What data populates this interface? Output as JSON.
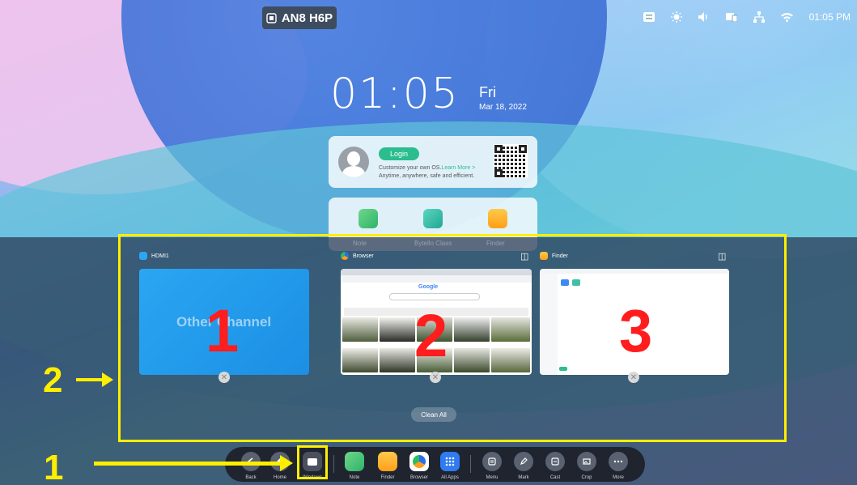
{
  "device_badge": {
    "label": "AN8 H6P"
  },
  "status_bar": {
    "time": "01:05 PM"
  },
  "clock": {
    "time": "01:05",
    "day": "Fri",
    "date": "Mar 18, 2022"
  },
  "login_card": {
    "button": "Login",
    "line1": "Customize your own OS.",
    "learn_more": "Learn More >",
    "line2": "Anytime, anywhere, safe and efficient."
  },
  "home_apps": [
    {
      "label": "Note"
    },
    {
      "label": "Bytello Class"
    },
    {
      "label": "Finder"
    }
  ],
  "tasks": [
    {
      "title": "HDMI1",
      "content": "Other Channel"
    },
    {
      "title": "Browser",
      "google": "Google"
    },
    {
      "title": "Finder"
    }
  ],
  "clean_all": "Clean All",
  "annotations": {
    "box_numbers": [
      "1",
      "2",
      "3"
    ],
    "arrow_labels": [
      "2",
      "1"
    ]
  },
  "dock": [
    {
      "label": "Back",
      "icon": "back-icon"
    },
    {
      "label": "Home",
      "icon": "home-icon"
    },
    {
      "label": "Windows",
      "icon": "windows-icon"
    },
    {
      "label": "Note",
      "icon": "note-icon"
    },
    {
      "label": "Finder",
      "icon": "finder-icon"
    },
    {
      "label": "Browser",
      "icon": "browser-icon"
    },
    {
      "label": "All Apps",
      "icon": "all-apps-icon"
    },
    {
      "label": "Menu",
      "icon": "menu-icon"
    },
    {
      "label": "Mark",
      "icon": "mark-icon"
    },
    {
      "label": "Cast",
      "icon": "cast-icon"
    },
    {
      "label": "Crop",
      "icon": "crop-icon"
    },
    {
      "label": "More",
      "icon": "more-icon"
    }
  ],
  "colors": {
    "annotation_yellow": "#ffee00",
    "annotation_red": "#ff1d1d",
    "accent_green": "#2bbd8e"
  }
}
